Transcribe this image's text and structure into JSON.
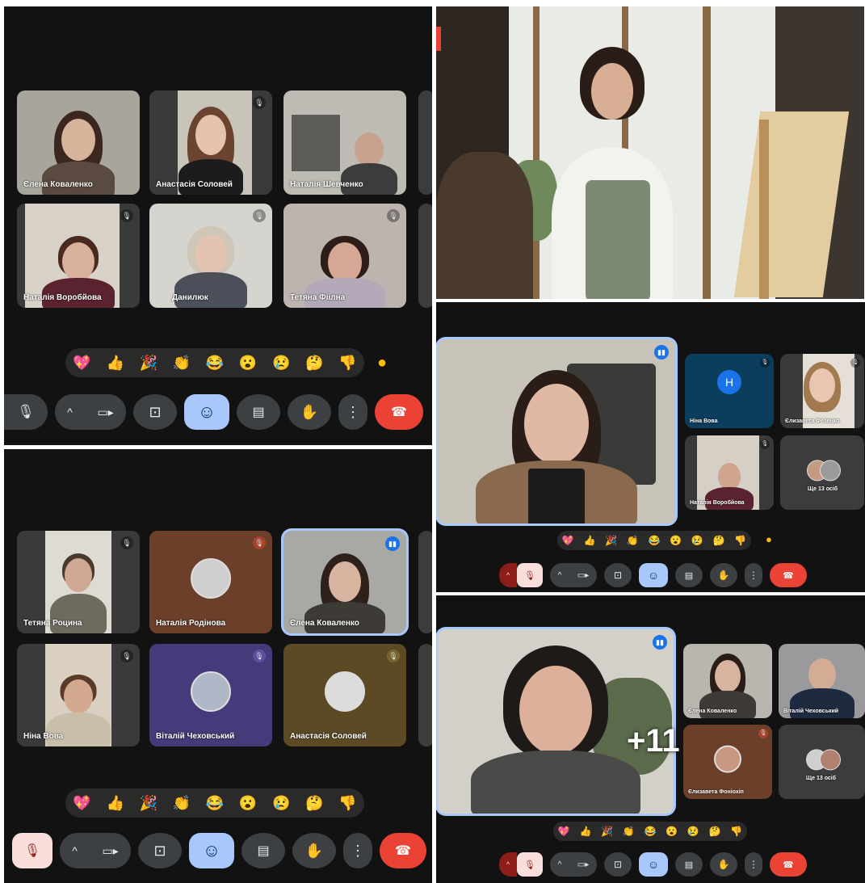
{
  "panel1": {
    "tiles": [
      {
        "name": "Єлена Коваленко"
      },
      {
        "name": "Анастасія Соловей"
      },
      {
        "name": "Наталія Шевченко"
      },
      {
        "name": "Наталія Воробйова"
      },
      {
        "name": "Данилюк"
      },
      {
        "name": "Тетяна Фіілна"
      }
    ],
    "reactions": [
      "💖",
      "👍",
      "🎉",
      "👏",
      "😂",
      "😮",
      "😢",
      "🤔",
      "👎"
    ],
    "raise_dot": "●"
  },
  "panel3": {
    "tiles": [
      {
        "name": "Тетяна Роцина"
      },
      {
        "name": "Наталія Родінова"
      },
      {
        "name": "Єлена Коваленко"
      },
      {
        "name": "Ніна Вова"
      },
      {
        "name": "Віталій Чеховський"
      },
      {
        "name": "Анастасія Соловей"
      }
    ],
    "reactions": [
      "💖",
      "👍",
      "🎉",
      "👏",
      "😂",
      "😮",
      "😢",
      "🤔",
      "👎"
    ]
  },
  "panel4": {
    "main_name": "",
    "side": [
      {
        "name": "Ніна Вова",
        "letter": "H"
      },
      {
        "name": "Єлизавета Фезенко"
      },
      {
        "name": "Наталія Воробйова"
      },
      {
        "name": "Ще 13 осіб"
      }
    ],
    "reactions": [
      "💖",
      "👍",
      "🎉",
      "👏",
      "😂",
      "😮",
      "😢",
      "🤔",
      "👎"
    ],
    "raise_dot": "●"
  },
  "panel5": {
    "side": [
      {
        "name": "Єлена Коваленко"
      },
      {
        "name": "Віталій Чеховський"
      },
      {
        "name": "Єлизавета Фоніохіп"
      },
      {
        "name": "Ще 13 осіб"
      }
    ],
    "overlay_count": "+11",
    "reactions": [
      "💖",
      "👍",
      "🎉",
      "👏",
      "😂",
      "😮",
      "😢",
      "🤔",
      "👎"
    ]
  },
  "controls": {
    "mic": "🎙",
    "mic_off": "🎙",
    "chevron": "^",
    "camera": "▭▸",
    "present": "⊡",
    "emoji": "☺",
    "captions": "▤",
    "hand": "✋",
    "more": "⋮",
    "hangup": "☎"
  },
  "colors": {
    "background": "#121212",
    "tile": "#3c3c3c",
    "accent_blue": "#a8c7fa",
    "hangup_red": "#ea4335"
  }
}
